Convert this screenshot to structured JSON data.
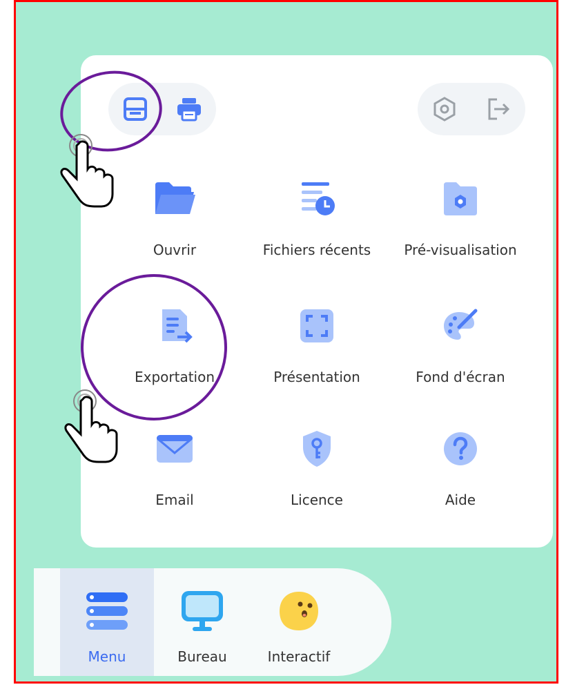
{
  "toolbar": {
    "left": [
      {
        "name": "save-icon",
        "label": ""
      },
      {
        "name": "print-icon",
        "label": ""
      }
    ],
    "right": [
      {
        "name": "settings-hexagon-icon",
        "label": ""
      },
      {
        "name": "exit-icon",
        "label": ""
      }
    ]
  },
  "menu_grid": [
    {
      "label": "Ouvrir",
      "icon": "folder-icon"
    },
    {
      "label": "Fichiers récents",
      "icon": "recent-files-icon"
    },
    {
      "label": "Pré-visualisation",
      "icon": "preview-folder-icon"
    },
    {
      "label": "Exportation",
      "icon": "export-document-icon"
    },
    {
      "label": "Présentation",
      "icon": "fullscreen-icon"
    },
    {
      "label": "Fond d'écran",
      "icon": "palette-brush-icon"
    },
    {
      "label": "Email",
      "icon": "envelope-icon"
    },
    {
      "label": "Licence",
      "icon": "shield-key-icon"
    },
    {
      "label": "Aide",
      "icon": "help-question-icon"
    }
  ],
  "dock": {
    "items": [
      {
        "label": "Menu",
        "icon": "menu-stack-icon",
        "active": true
      },
      {
        "label": "Bureau",
        "icon": "monitor-icon",
        "active": false
      },
      {
        "label": "Interactif",
        "icon": "emoji-face-icon",
        "active": false
      }
    ]
  },
  "colors": {
    "background": "#a6ebd2",
    "frame_border": "#ff0000",
    "icon_blue": "#4d7cf6",
    "icon_light_blue": "#a9c3fb",
    "toolbar_gray": "#9aa0a6",
    "annotation_purple": "#6a1b9a",
    "active_label": "#3b6bf0"
  }
}
